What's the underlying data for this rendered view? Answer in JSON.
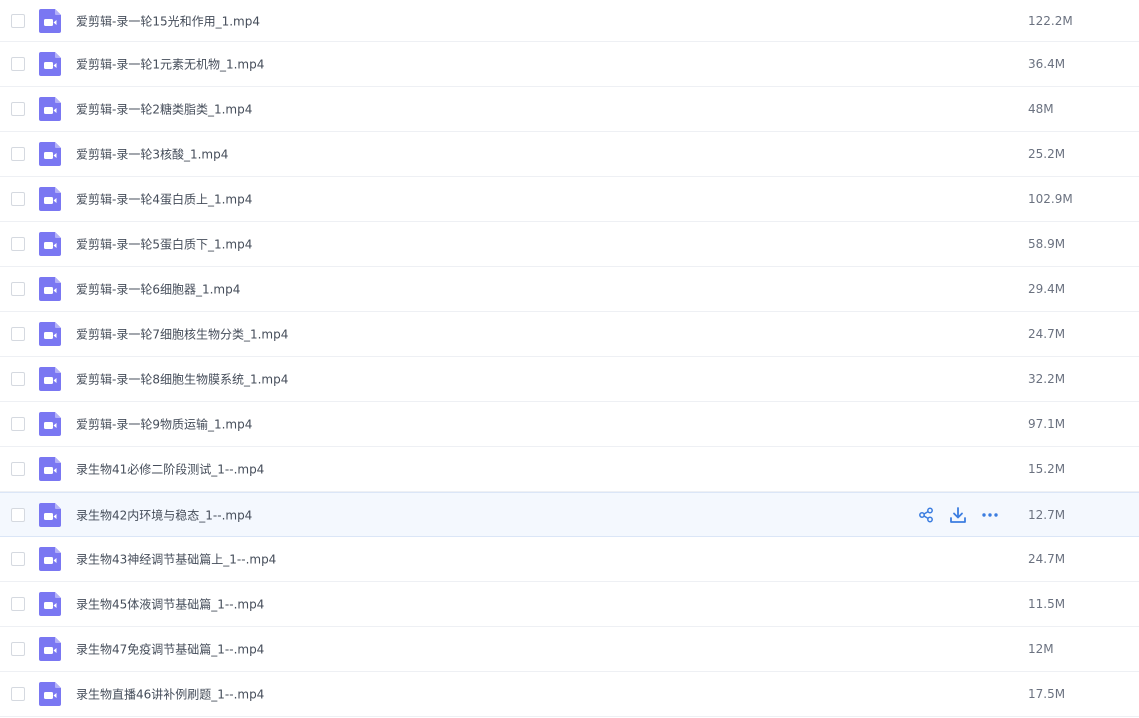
{
  "colors": {
    "accent": "#3b7de0",
    "icon_purple": "#7a77f2",
    "hover_bg": "#f4f8fe"
  },
  "file_icon": "video-file-icon",
  "row_actions": [
    "share-icon",
    "download-icon",
    "more-icon"
  ],
  "files": [
    {
      "name": "爱剪辑-录一轮15光和作用_1.mp4",
      "size": "122.2M"
    },
    {
      "name": "爱剪辑-录一轮1元素无机物_1.mp4",
      "size": "36.4M"
    },
    {
      "name": "爱剪辑-录一轮2糖类脂类_1.mp4",
      "size": "48M"
    },
    {
      "name": "爱剪辑-录一轮3核酸_1.mp4",
      "size": "25.2M"
    },
    {
      "name": "爱剪辑-录一轮4蛋白质上_1.mp4",
      "size": "102.9M"
    },
    {
      "name": "爱剪辑-录一轮5蛋白质下_1.mp4",
      "size": "58.9M"
    },
    {
      "name": "爱剪辑-录一轮6细胞器_1.mp4",
      "size": "29.4M"
    },
    {
      "name": "爱剪辑-录一轮7细胞核生物分类_1.mp4",
      "size": "24.7M"
    },
    {
      "name": "爱剪辑-录一轮8细胞生物膜系统_1.mp4",
      "size": "32.2M"
    },
    {
      "name": "爱剪辑-录一轮9物质运输_1.mp4",
      "size": "97.1M"
    },
    {
      "name": "录生物41必修二阶段测试_1--.mp4",
      "size": "15.2M"
    },
    {
      "name": "录生物42内环境与稳态_1--.mp4",
      "size": "12.7M",
      "hovered": true
    },
    {
      "name": "录生物43神经调节基础篇上_1--.mp4",
      "size": "24.7M"
    },
    {
      "name": "录生物45体液调节基础篇_1--.mp4",
      "size": "11.5M"
    },
    {
      "name": "录生物47免疫调节基础篇_1--.mp4",
      "size": "12M"
    },
    {
      "name": "录生物直播46讲补例刷题_1--.mp4",
      "size": "17.5M"
    }
  ]
}
